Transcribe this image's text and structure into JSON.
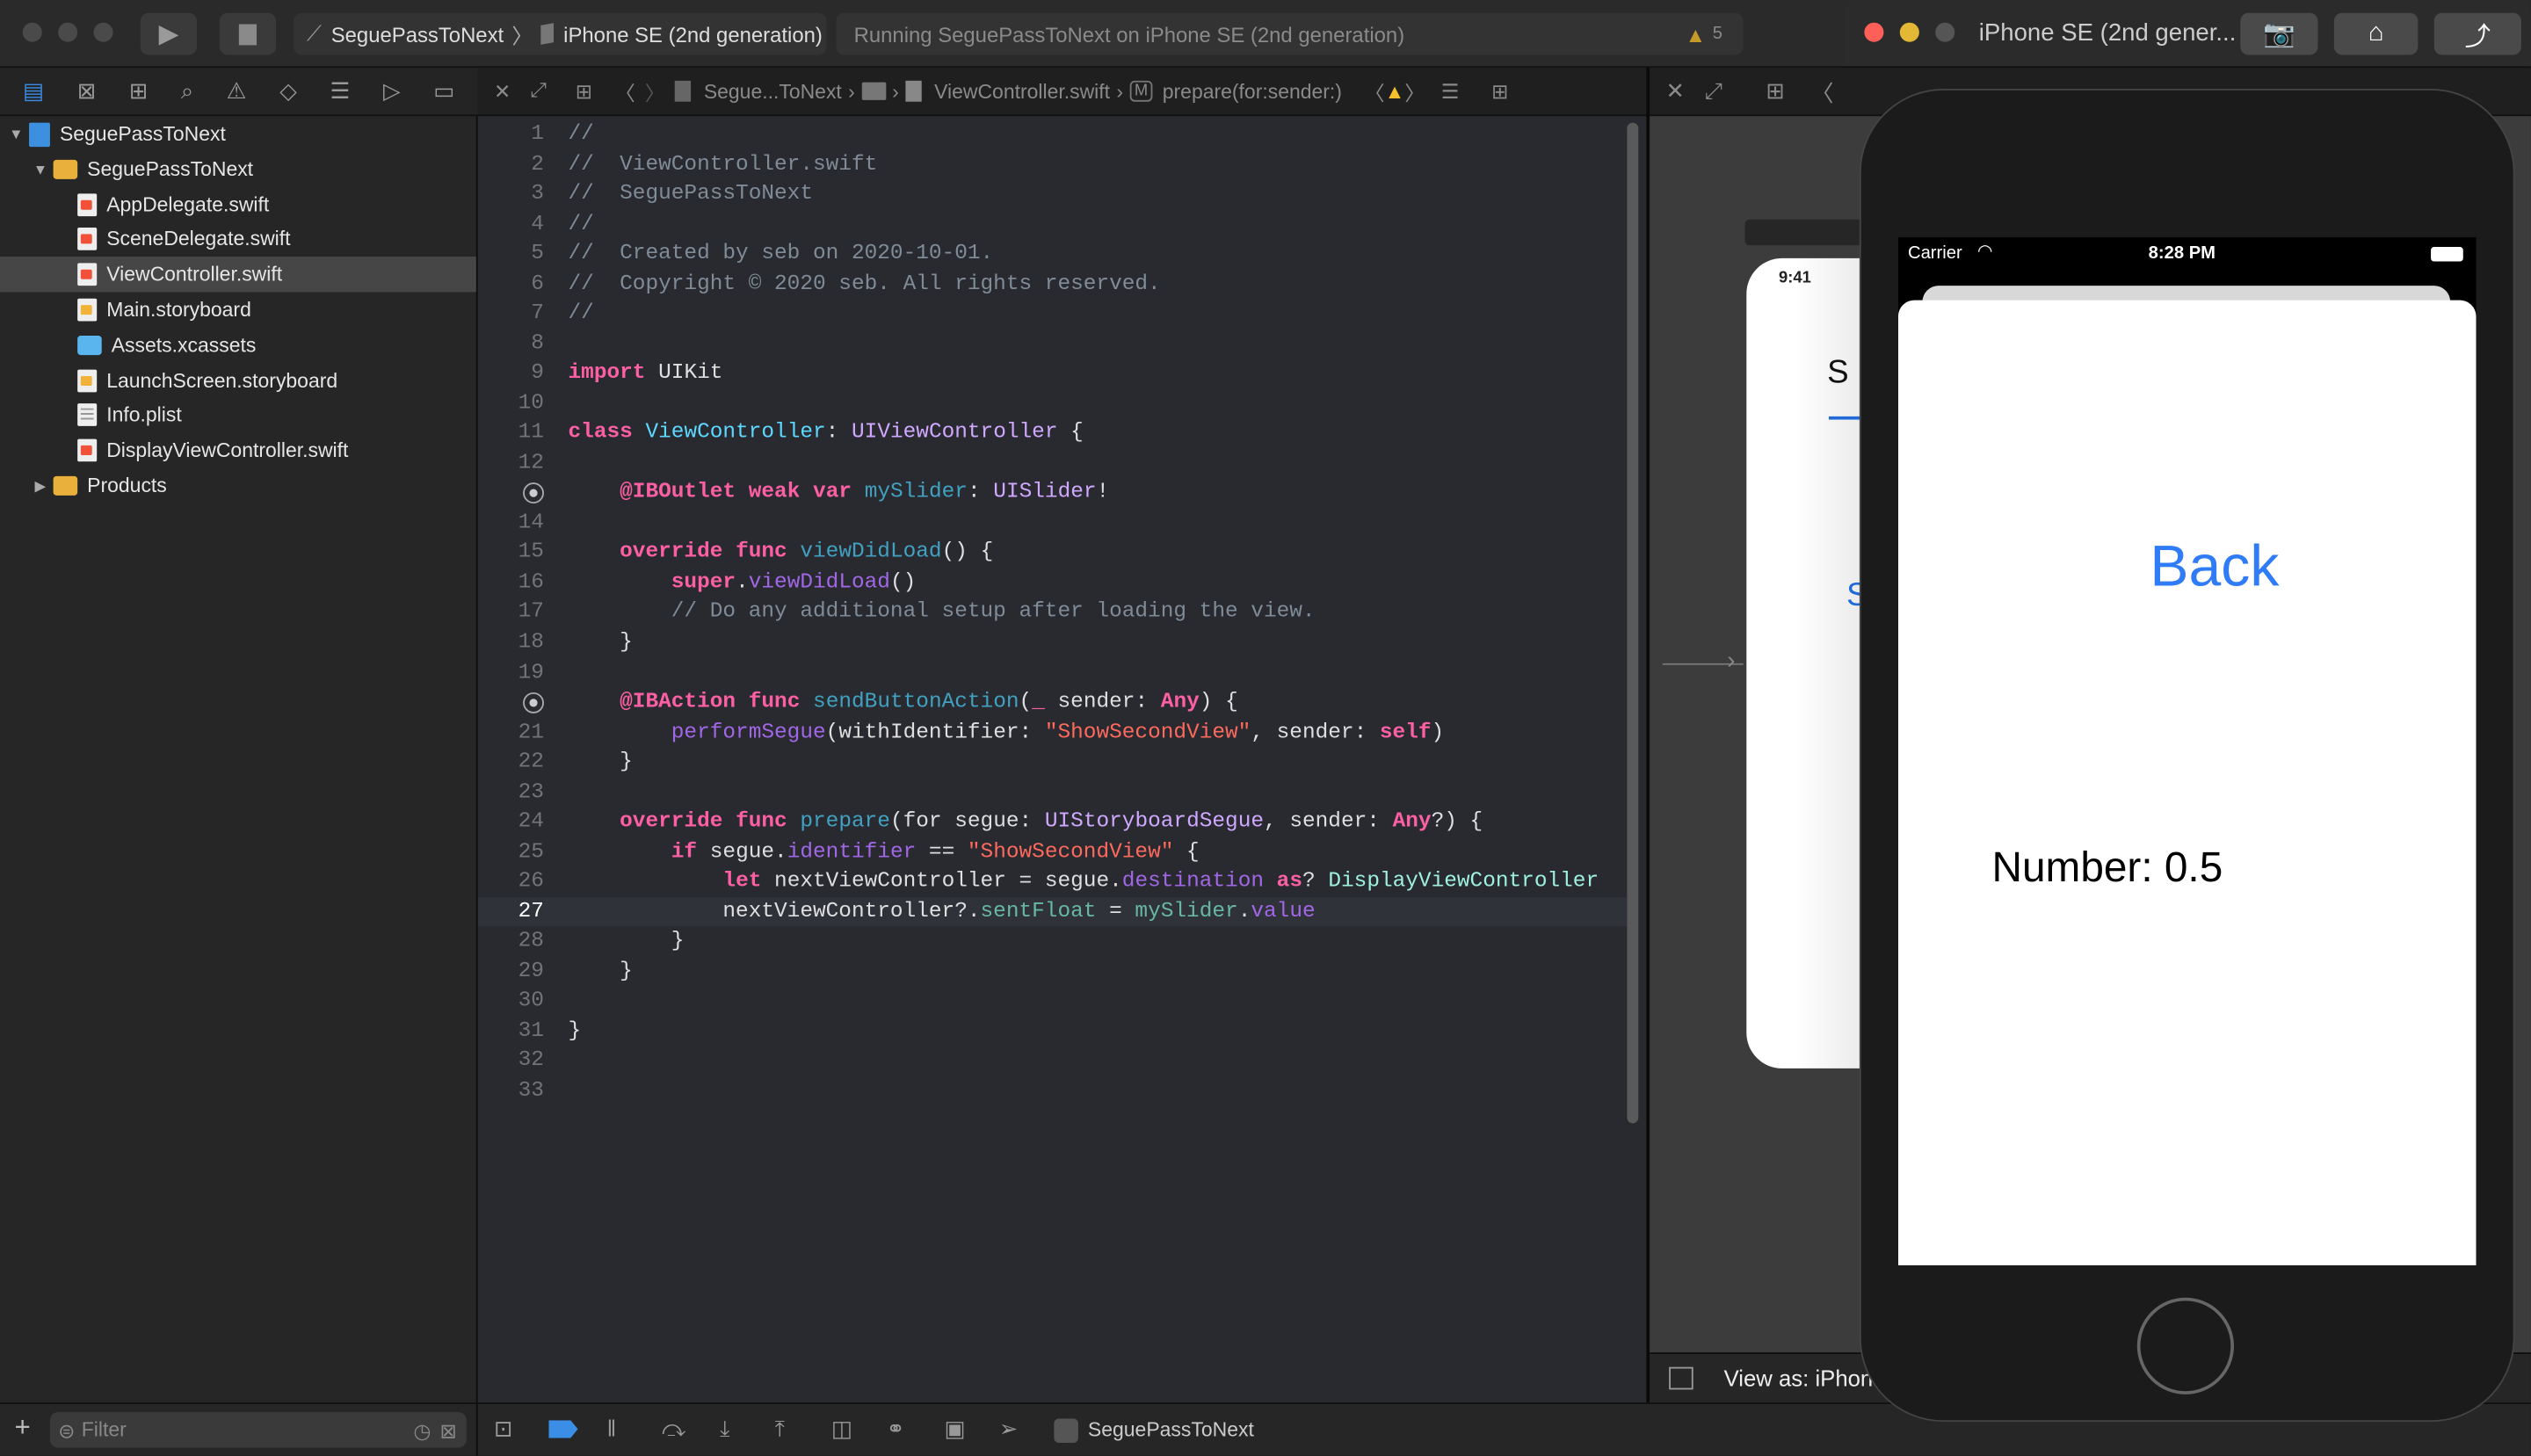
{
  "toolbar": {
    "scheme": "SeguePassToNext",
    "destination": "iPhone SE (2nd generation)",
    "status": "Running SeguePassToNext on iPhone SE (2nd generation)",
    "warning_count": "5",
    "icons": [
      "play-icon",
      "stop-icon",
      "warning-icon"
    ]
  },
  "simulator": {
    "title": "iPhone SE (2nd gener...",
    "status_bar": {
      "carrier": "Carrier",
      "time": "8:28 PM"
    },
    "back_label": "Back",
    "number_label": "Number: 0.5",
    "tint_color": "#2f7cf6"
  },
  "navigator": {
    "items": [
      {
        "label": "SeguePassToNext",
        "icon": "project",
        "indent": 0,
        "disclosure": "open"
      },
      {
        "label": "SeguePassToNext",
        "icon": "folder",
        "indent": 1,
        "disclosure": "open"
      },
      {
        "label": "AppDelegate.swift",
        "icon": "swift",
        "indent": 2
      },
      {
        "label": "SceneDelegate.swift",
        "icon": "swift",
        "indent": 2
      },
      {
        "label": "ViewController.swift",
        "icon": "swift",
        "indent": 2,
        "selected": true
      },
      {
        "label": "Main.storyboard",
        "icon": "sb",
        "indent": 2
      },
      {
        "label": "Assets.xcassets",
        "icon": "assets",
        "indent": 2
      },
      {
        "label": "LaunchScreen.storyboard",
        "icon": "sb",
        "indent": 2
      },
      {
        "label": "Info.plist",
        "icon": "plist",
        "indent": 2
      },
      {
        "label": "DisplayViewController.swift",
        "icon": "swift",
        "indent": 2
      },
      {
        "label": "Products",
        "icon": "folder",
        "indent": 1,
        "disclosure": "closed"
      }
    ],
    "filter_placeholder": "Filter"
  },
  "jumpbar": {
    "project": "Segue...ToNext",
    "file": "ViewController.swift",
    "symbol_badge": "M",
    "symbol": "prepare(for:sender:)"
  },
  "editor": {
    "current_line": 27,
    "outlet_connected_lines": [
      13,
      20
    ],
    "lines": [
      [
        [
          "c",
          "//"
        ]
      ],
      [
        [
          "c",
          "//  ViewController.swift"
        ]
      ],
      [
        [
          "c",
          "//  SeguePassToNext"
        ]
      ],
      [
        [
          "c",
          "//"
        ]
      ],
      [
        [
          "c",
          "//  Created by seb on 2020-10-01."
        ]
      ],
      [
        [
          "c",
          "//  Copyright © 2020 seb. All rights reserved."
        ]
      ],
      [
        [
          "c",
          "//"
        ]
      ],
      [],
      [
        [
          "k",
          "import"
        ],
        [
          "p",
          " UIKit"
        ]
      ],
      [],
      [
        [
          "k",
          "class"
        ],
        [
          "p",
          " "
        ],
        [
          "dc",
          "ViewController"
        ],
        [
          "p",
          ": "
        ],
        [
          "t",
          "UIViewController"
        ],
        [
          "p",
          " {"
        ]
      ],
      [],
      [
        [
          "p",
          "    "
        ],
        [
          "k",
          "@IBOutlet"
        ],
        [
          "p",
          " "
        ],
        [
          "k",
          "weak"
        ],
        [
          "p",
          " "
        ],
        [
          "k",
          "var"
        ],
        [
          "p",
          " "
        ],
        [
          "d",
          "mySlider"
        ],
        [
          "p",
          ": "
        ],
        [
          "t",
          "UISlider"
        ],
        [
          "p",
          "!"
        ]
      ],
      [],
      [
        [
          "p",
          "    "
        ],
        [
          "k",
          "override"
        ],
        [
          "p",
          " "
        ],
        [
          "k",
          "func"
        ],
        [
          "p",
          " "
        ],
        [
          "d",
          "viewDidLoad"
        ],
        [
          "p",
          "() {"
        ]
      ],
      [
        [
          "p",
          "        "
        ],
        [
          "k",
          "super"
        ],
        [
          "p",
          "."
        ],
        [
          "m",
          "viewDidLoad"
        ],
        [
          "p",
          "()"
        ]
      ],
      [
        [
          "p",
          "        "
        ],
        [
          "c",
          "// Do any additional setup after loading the view."
        ]
      ],
      [
        [
          "p",
          "    }"
        ]
      ],
      [],
      [
        [
          "p",
          "    "
        ],
        [
          "k",
          "@IBAction"
        ],
        [
          "p",
          " "
        ],
        [
          "k",
          "func"
        ],
        [
          "p",
          " "
        ],
        [
          "d",
          "sendButtonAction"
        ],
        [
          "p",
          "("
        ],
        [
          "k",
          "_"
        ],
        [
          "p",
          " sender: "
        ],
        [
          "k",
          "Any"
        ],
        [
          "p",
          ") {"
        ]
      ],
      [
        [
          "p",
          "        "
        ],
        [
          "m",
          "performSegue"
        ],
        [
          "p",
          "(withIdentifier: "
        ],
        [
          "s",
          "\"ShowSecondView\""
        ],
        [
          "p",
          ", sender: "
        ],
        [
          "k",
          "self"
        ],
        [
          "p",
          ")"
        ]
      ],
      [
        [
          "p",
          "    }"
        ]
      ],
      [],
      [
        [
          "p",
          "    "
        ],
        [
          "k",
          "override"
        ],
        [
          "p",
          " "
        ],
        [
          "k",
          "func"
        ],
        [
          "p",
          " "
        ],
        [
          "d",
          "prepare"
        ],
        [
          "p",
          "(for segue: "
        ],
        [
          "t",
          "UIStoryboardSegue"
        ],
        [
          "p",
          ", sender: "
        ],
        [
          "k",
          "Any"
        ],
        [
          "p",
          "?) {"
        ]
      ],
      [
        [
          "p",
          "        "
        ],
        [
          "k",
          "if"
        ],
        [
          "p",
          " segue."
        ],
        [
          "m",
          "identifier"
        ],
        [
          "p",
          " == "
        ],
        [
          "s",
          "\"ShowSecondView\""
        ],
        [
          "p",
          " {"
        ]
      ],
      [
        [
          "p",
          "            "
        ],
        [
          "k",
          "let"
        ],
        [
          "p",
          " nextViewController = segue."
        ],
        [
          "m",
          "destination"
        ],
        [
          "p",
          " "
        ],
        [
          "k",
          "as"
        ],
        [
          "p",
          "? "
        ],
        [
          "pt",
          "DisplayViewController"
        ]
      ],
      [
        [
          "p",
          "            nextViewController?."
        ],
        [
          "pm",
          "sentFloat"
        ],
        [
          "p",
          " = "
        ],
        [
          "pm",
          "mySlider"
        ],
        [
          "p",
          "."
        ],
        [
          "m",
          "value"
        ]
      ],
      [
        [
          "p",
          "        }"
        ]
      ],
      [
        [
          "p",
          "    }"
        ]
      ],
      [],
      [
        [
          "p",
          "}"
        ]
      ],
      [],
      []
    ]
  },
  "storyboard": {
    "time": "9:41",
    "label_partial": "S",
    "button_partial": "S",
    "view_as": "View as: iPhon"
  },
  "debugbar": {
    "target": "SeguePassToNext"
  }
}
